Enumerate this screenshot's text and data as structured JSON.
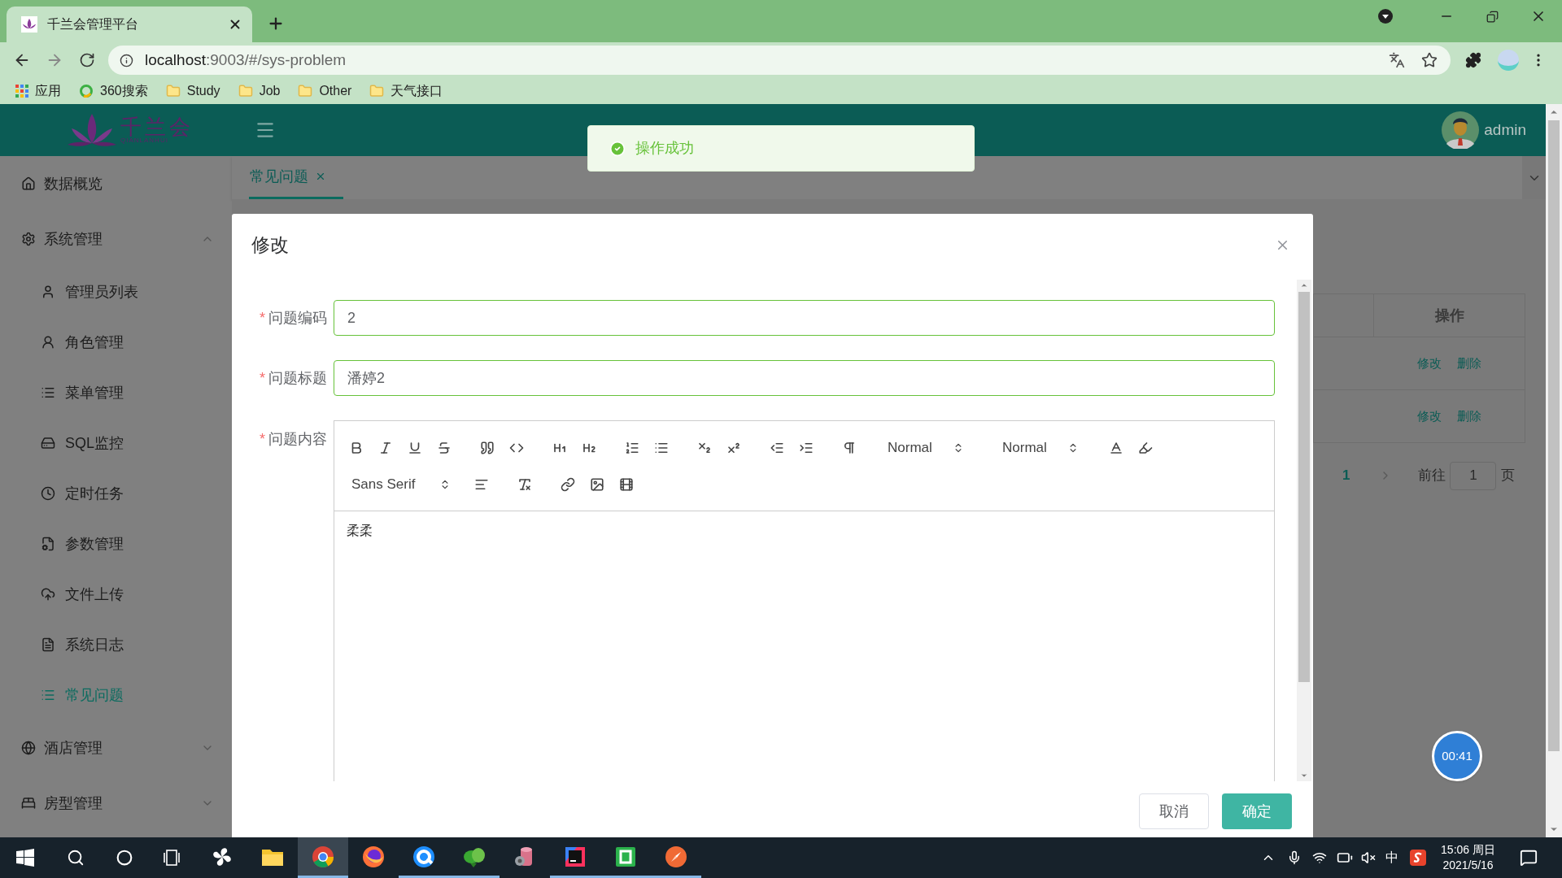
{
  "browser": {
    "tab_title": "千兰会管理平台",
    "url_host": "localhost",
    "url_path": ":9003/#/sys-problem",
    "bookmarks": [
      {
        "label": "应用",
        "kind": "apps"
      },
      {
        "label": "360搜索",
        "kind": "site"
      },
      {
        "label": "Study",
        "kind": "folder"
      },
      {
        "label": "Job",
        "kind": "folder"
      },
      {
        "label": "Other",
        "kind": "folder"
      },
      {
        "label": "天气接口",
        "kind": "folder"
      }
    ]
  },
  "header": {
    "logo_text": "千兰会",
    "logo_subtext": "QIANLANHUI",
    "user": "admin"
  },
  "sidebar": {
    "items": [
      {
        "label": "数据概览",
        "selected": false
      },
      {
        "label": "系统管理",
        "selected": false,
        "expanded": true,
        "children": [
          {
            "label": "管理员列表",
            "selected": false
          },
          {
            "label": "角色管理",
            "selected": false
          },
          {
            "label": "菜单管理",
            "selected": false
          },
          {
            "label": "SQL监控",
            "selected": false
          },
          {
            "label": "定时任务",
            "selected": false
          },
          {
            "label": "参数管理",
            "selected": false
          },
          {
            "label": "文件上传",
            "selected": false
          },
          {
            "label": "系统日志",
            "selected": false
          },
          {
            "label": "常见问题",
            "selected": true
          }
        ]
      },
      {
        "label": "酒店管理",
        "selected": false,
        "expanded": false
      },
      {
        "label": "房型管理",
        "selected": false,
        "expanded": false
      }
    ]
  },
  "tabs": [
    {
      "label": "常见问题",
      "selected": true
    }
  ],
  "table": {
    "columns": [
      "操作"
    ],
    "rows": [
      {
        "actions": [
          "修改",
          "删除"
        ]
      },
      {
        "actions": [
          "修改",
          "删除"
        ]
      }
    ]
  },
  "pagination": {
    "pages": [
      {
        "label": "1",
        "selected": true
      }
    ],
    "goto_label": "前往",
    "goto_value": "1",
    "goto_suffix": "页"
  },
  "toast": {
    "message": "操作成功"
  },
  "dialog": {
    "title": "修改",
    "fields": [
      {
        "label": "问题编码",
        "required_mark": "*",
        "kind": "input",
        "value": "2"
      },
      {
        "label": "问题标题",
        "required_mark": "*",
        "kind": "input",
        "value": "潘婷2"
      },
      {
        "label": "问题内容",
        "required_mark": "*",
        "kind": "editor"
      }
    ],
    "editor": {
      "selects": [
        "Normal",
        "Normal",
        "Sans Serif"
      ],
      "content": "柔柔"
    },
    "buttons": [
      {
        "label": "取消",
        "kind": "default"
      },
      {
        "label": "确定",
        "kind": "primary"
      }
    ]
  },
  "timer": "00:41",
  "taskbar": {
    "apps": [
      {
        "running": false,
        "selected": false
      },
      {
        "running": false,
        "selected": false
      },
      {
        "running": true,
        "selected": true
      },
      {
        "running": false,
        "selected": false
      },
      {
        "running": true,
        "selected": false
      },
      {
        "running": true,
        "selected": false
      },
      {
        "running": false,
        "selected": false
      },
      {
        "running": true,
        "selected": false
      },
      {
        "running": true,
        "selected": false
      },
      {
        "running": true,
        "selected": false
      }
    ],
    "ime": "中",
    "time": "15:06 周日",
    "date": "2021/5/16"
  }
}
